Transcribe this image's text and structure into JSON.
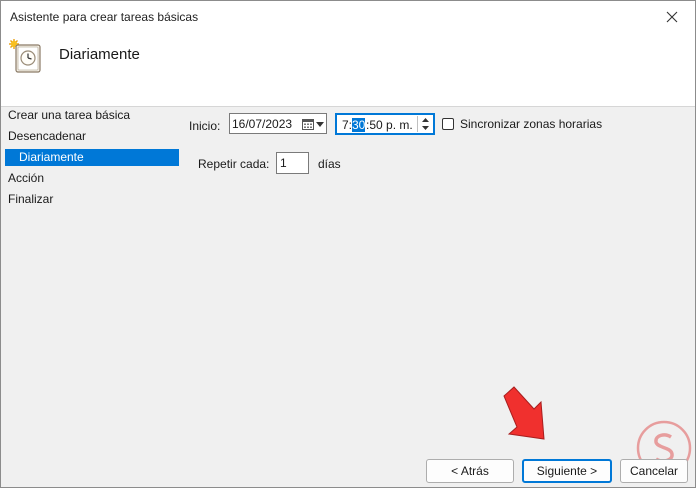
{
  "window": {
    "title": "Asistente para crear tareas básicas"
  },
  "header": {
    "title": "Diariamente",
    "icon": "clock-sun-icon"
  },
  "sidebar": {
    "items": [
      {
        "label": "Crear una tarea básica",
        "active": false
      },
      {
        "label": "Desencadenar",
        "active": false
      },
      {
        "label": "Diariamente",
        "active": true
      },
      {
        "label": "Acción",
        "active": false
      },
      {
        "label": "Finalizar",
        "active": false
      }
    ]
  },
  "form": {
    "start_label": "Inicio:",
    "date_value": "16/07/2023",
    "time_hour": "7:",
    "time_minutes_selected": "30",
    "time_rest": ":50 p. m.",
    "sync_label": "Sincronizar zonas horarias",
    "sync_checked": false,
    "repeat_label": "Repetir cada:",
    "repeat_value": "1",
    "repeat_unit": "días"
  },
  "buttons": {
    "back": "< Atrás",
    "next": "Siguiente >",
    "cancel": "Cancelar"
  },
  "colors": {
    "accent": "#0078d7",
    "annotation_arrow": "#f0302e",
    "watermark": "#e05a5a"
  }
}
